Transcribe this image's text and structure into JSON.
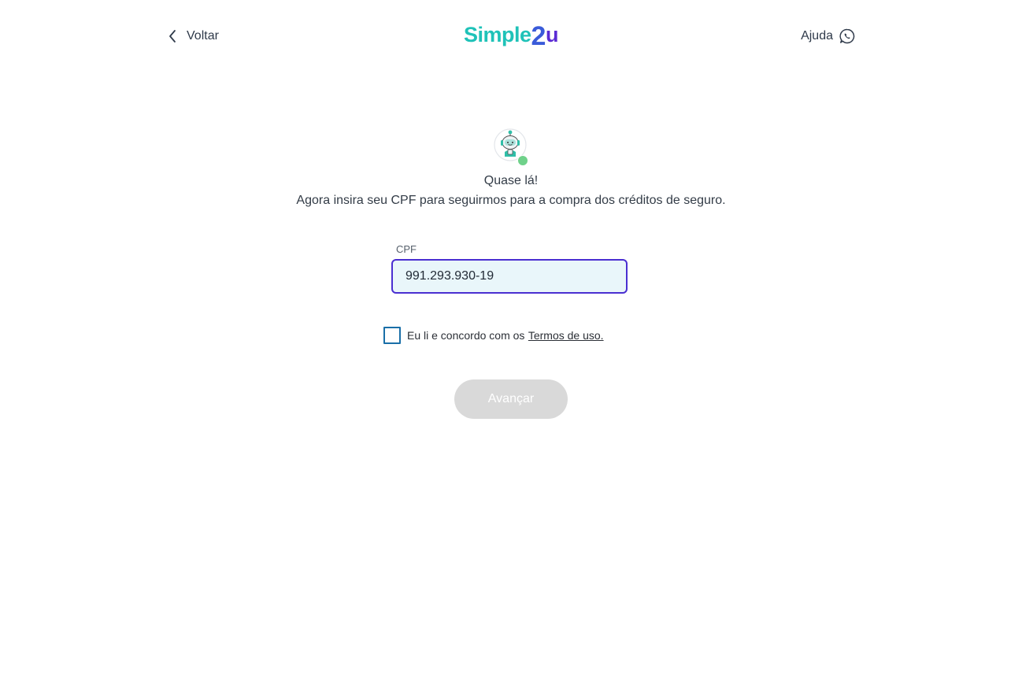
{
  "header": {
    "back_label": "Voltar",
    "logo": {
      "part1": "Simple",
      "part2": "2",
      "part3": "u"
    },
    "help_label": "Ajuda",
    "icons": {
      "back": "chevron-left-icon",
      "help": "whatsapp-icon"
    }
  },
  "intro": {
    "avatar_icon": "robot-assistant-icon",
    "avatar_status": "online",
    "headline": "Quase lá!",
    "subline": "Agora insira seu CPF para seguirmos para a compra dos créditos de seguro."
  },
  "form": {
    "cpf_label": "CPF",
    "cpf_value": "991.293.930-19",
    "terms_text": "Eu li e concordo com os",
    "terms_link": "Termos de uso.",
    "terms_checked": false,
    "submit_label": "Avançar",
    "submit_enabled": false
  },
  "colors": {
    "brand_teal": "#1fc2b8",
    "brand_blue": "#3a5bd9",
    "brand_purple": "#5b2bd4",
    "input_border_focus": "#4a2fd1",
    "input_bg": "#e9f6fa",
    "checkbox_border": "#1a6fa8",
    "button_disabled": "#d9d9d9",
    "status_online": "#6fd18a"
  }
}
